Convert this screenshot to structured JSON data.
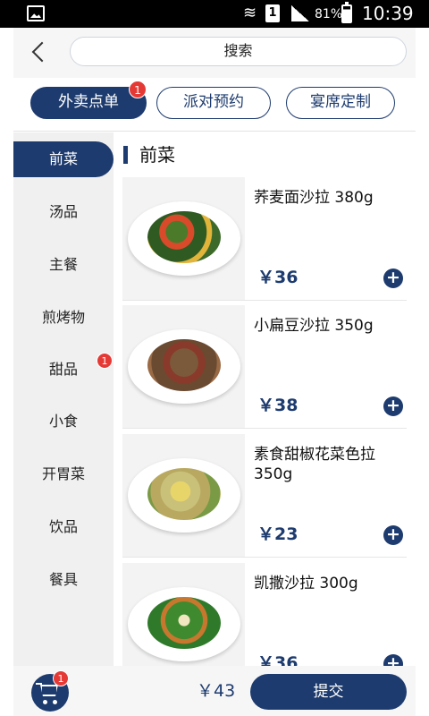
{
  "status_bar": {
    "battery": "81%",
    "time": "10:39",
    "sim_slot": "1"
  },
  "header": {
    "search_label": "搜索"
  },
  "tabs": [
    {
      "label": "外卖点单",
      "active": true,
      "badge": "1"
    },
    {
      "label": "派对预约",
      "active": false
    },
    {
      "label": "宴席定制",
      "active": false
    }
  ],
  "sidebar": {
    "items": [
      {
        "label": "前菜",
        "active": true
      },
      {
        "label": "汤品"
      },
      {
        "label": "主餐"
      },
      {
        "label": "煎烤物"
      },
      {
        "label": "甜品",
        "badge": "1"
      },
      {
        "label": "小食"
      },
      {
        "label": "开胃菜"
      },
      {
        "label": "饮品"
      },
      {
        "label": "餐具"
      }
    ]
  },
  "section": {
    "title": "前菜"
  },
  "dishes": [
    {
      "name": "荞麦面沙拉 380g",
      "price": "￥36"
    },
    {
      "name": "小扁豆沙拉 350g",
      "price": "￥38"
    },
    {
      "name": "素食甜椒花菜色拉 350g",
      "price": "￥23"
    },
    {
      "name": "凯撒沙拉 300g",
      "price": "￥36"
    }
  ],
  "add_symbol": "+",
  "bottom_bar": {
    "cart_badge": "1",
    "total": "￥43",
    "submit_label": "提交"
  },
  "colors": {
    "primary": "#1d3b6e",
    "badge": "#e53935"
  }
}
